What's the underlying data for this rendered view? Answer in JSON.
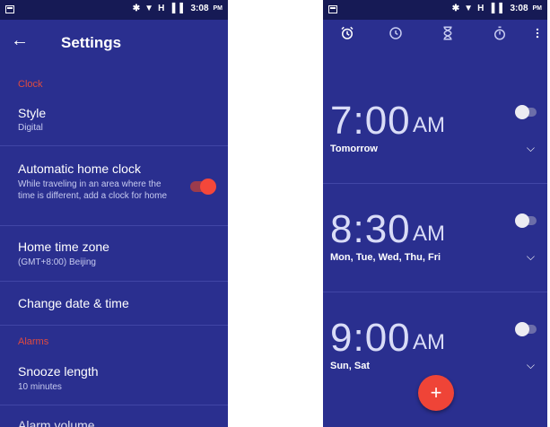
{
  "status_bar": {
    "time": "3:08",
    "ampm": "PM",
    "network": "H"
  },
  "settings": {
    "title": "Settings",
    "sections": {
      "clock": "Clock",
      "alarms": "Alarms"
    },
    "style": {
      "title": "Style",
      "value": "Digital"
    },
    "auto_home": {
      "title": "Automatic home clock",
      "desc": "While traveling in an area where the time is different, add a clock for home",
      "enabled": true
    },
    "home_tz": {
      "title": "Home time zone",
      "value": "(GMT+8:00) Beijing"
    },
    "change_dt": {
      "title": "Change date & time"
    },
    "snooze": {
      "title": "Snooze length",
      "value": "10 minutes"
    },
    "alarm_volume": {
      "title": "Alarm volume"
    }
  },
  "clock_app": {
    "tabs": [
      "alarm-icon",
      "clock-icon",
      "timer-icon",
      "stopwatch-icon"
    ],
    "alarms": [
      {
        "time": "7:00",
        "ampm": "AM",
        "days": "Tomorrow",
        "enabled": false
      },
      {
        "time": "8:30",
        "ampm": "AM",
        "days": "Mon, Tue, Wed, Thu, Fri",
        "enabled": false
      },
      {
        "time": "9:00",
        "ampm": "AM",
        "days": "Sun, Sat",
        "enabled": false
      }
    ],
    "fab_label": "+"
  },
  "colors": {
    "background": "#2a2f8f",
    "accent": "#ef4437"
  }
}
